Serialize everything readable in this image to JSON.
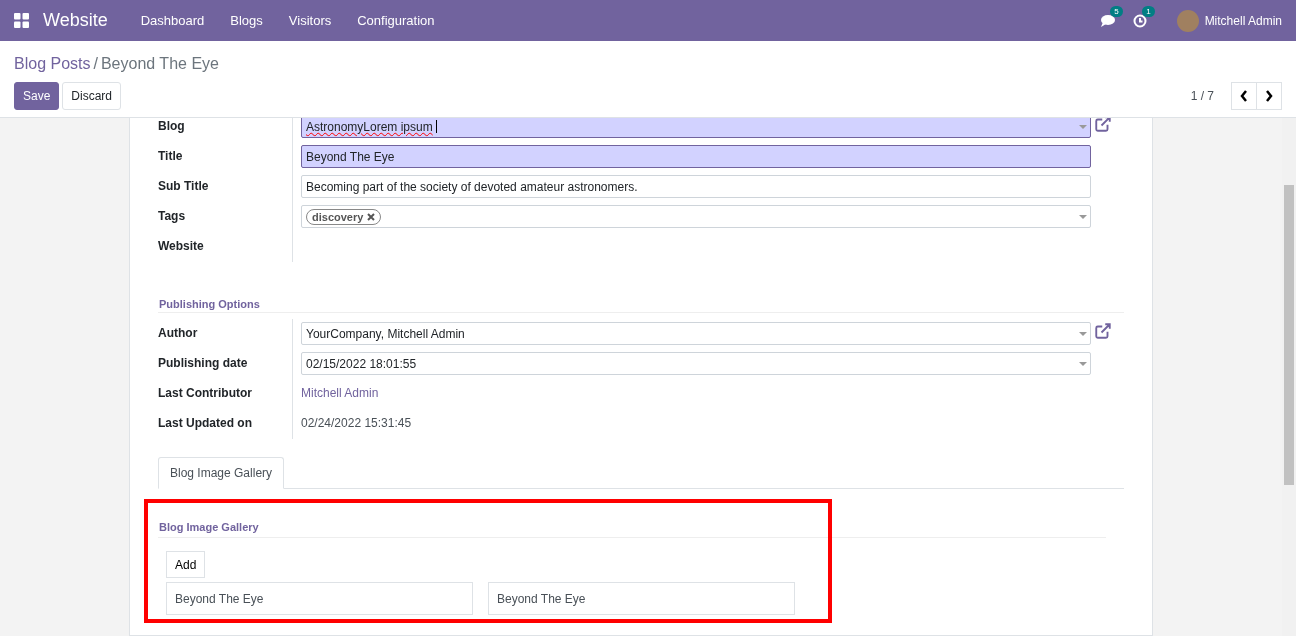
{
  "navbar": {
    "app_name": "Website",
    "menu": [
      "Dashboard",
      "Blogs",
      "Visitors",
      "Configuration"
    ],
    "messages_count": "5",
    "activities_count": "1",
    "user_name": "Mitchell Admin"
  },
  "breadcrumb": {
    "parent": "Blog Posts",
    "separator": "/",
    "current": "Beyond The Eye"
  },
  "buttons": [
    {
      "label": "Save",
      "kind": "primary"
    },
    {
      "label": "Discard",
      "kind": "secondary"
    }
  ],
  "pager": {
    "text": "1 / 7"
  },
  "main_group": [
    {
      "label": "Blog",
      "kind": "many2one",
      "value": "AstronomyLorem ipsum",
      "required": true,
      "focused": true
    },
    {
      "label": "Title",
      "kind": "char",
      "value": "Beyond The Eye",
      "required": true,
      "focused": false
    },
    {
      "label": "Sub Title",
      "kind": "char",
      "value": "Becoming part of the society of devoted amateur astronomers.",
      "required": false,
      "focused": false
    },
    {
      "label": "Tags",
      "kind": "tags",
      "tags": [
        "discovery"
      ],
      "required": false,
      "focused": false
    },
    {
      "label": "Website",
      "kind": "empty"
    }
  ],
  "publishing_options": {
    "title": "Publishing Options",
    "fields": [
      {
        "label": "Author",
        "kind": "many2one",
        "value": "YourCompany, Mitchell Admin",
        "required": false,
        "focused": false
      },
      {
        "label": "Publishing date",
        "kind": "date",
        "value": "02/15/2022 18:01:55",
        "required": false,
        "focused": false
      },
      {
        "label": "Last Contributor",
        "kind": "link",
        "value": "Mitchell Admin"
      },
      {
        "label": "Last Updated on",
        "kind": "text",
        "value": "02/24/2022 15:31:45"
      }
    ]
  },
  "tabs": [
    {
      "label": "Blog Image Gallery",
      "selected": true
    }
  ],
  "gallery": {
    "title": "Blog Image Gallery",
    "highlighted": true,
    "add_button": "Add",
    "items": [
      "Beyond The Eye",
      "Beyond The Eye"
    ]
  }
}
